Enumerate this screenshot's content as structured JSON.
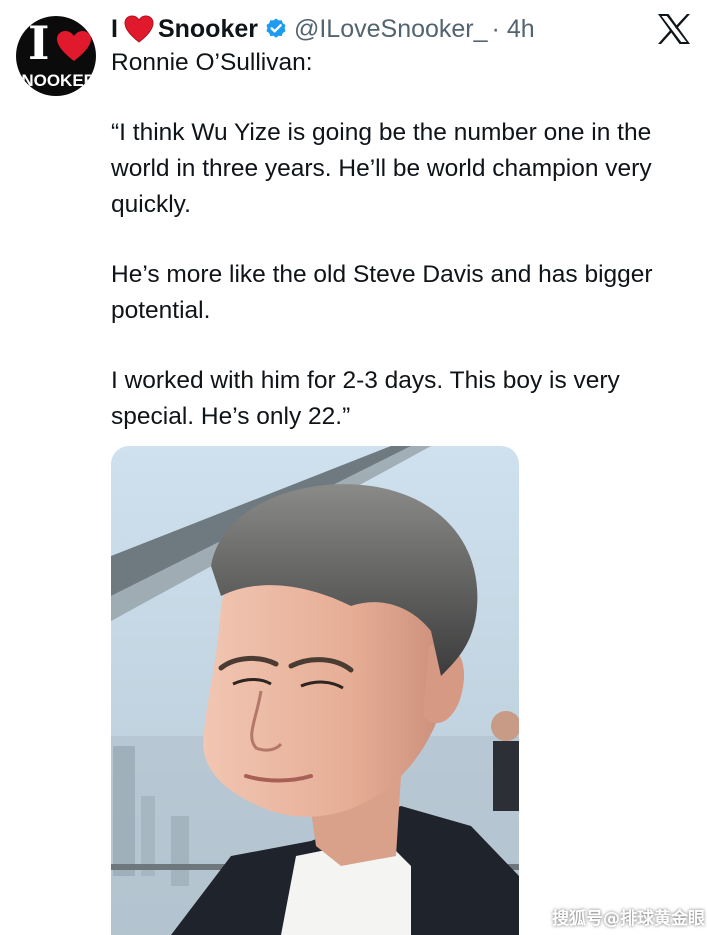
{
  "author": {
    "avatar_big_letter": "I",
    "avatar_brand_text": "SNOOKER",
    "display_name_prefix": "I",
    "display_name_suffix": "Snooker",
    "handle": "@ILoveSnooker_",
    "separator_time": "· 4h",
    "verified_icon": "verified-badge-icon",
    "heart_icon": "red-heart-icon"
  },
  "tweet": {
    "lines": [
      "Ronnie O’Sullivan:",
      "“I think Wu Yize is going be the number one in the world in three years. He’ll be world champion very quickly.",
      "He’s more like the old Steve Davis and has bigger potential.",
      "I worked with him for 2-3 days. This boy is very special. He’s only 22.”"
    ]
  },
  "platform_logo": "x-logo-icon",
  "media": {
    "type": "photo",
    "subject": "portrait-photo"
  },
  "watermark": "搜狐号@排球黄金眼",
  "colors": {
    "text": "#0f1419",
    "muted": "#536471",
    "verified": "#1d9bf0",
    "heart": "#e0192d"
  }
}
